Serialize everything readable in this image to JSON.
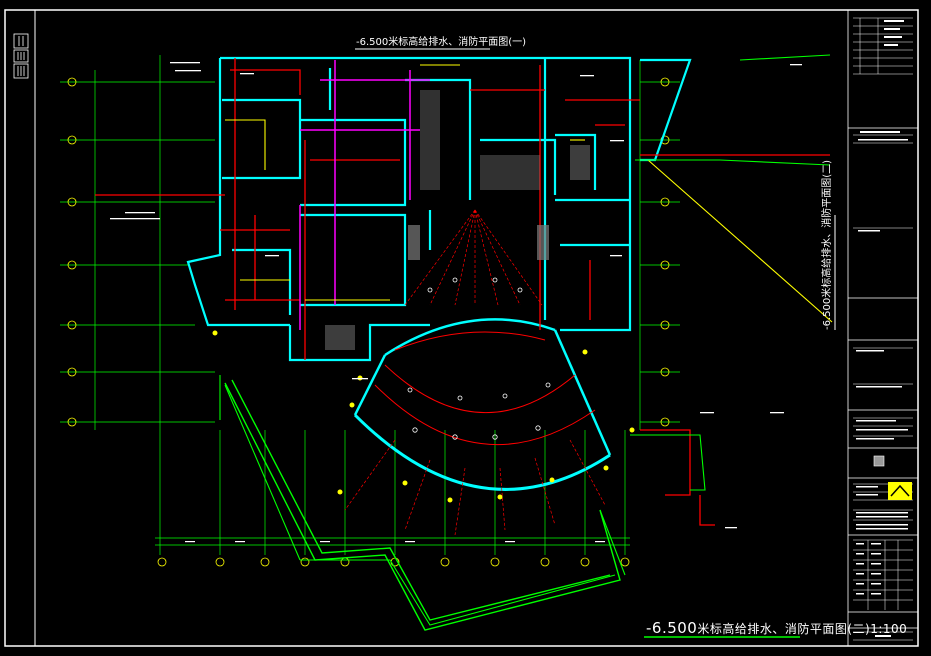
{
  "drawing": {
    "main_title_elevation": "-6.500",
    "main_title_text": "米标高给排水、消防平面图(二)",
    "main_title_scale": "1:100",
    "top_title": "-6.500米标高给排水、消防平面图(一)",
    "side_title": "-6.500米标高给排水、消防平面图(二)"
  },
  "left_panel": {
    "marks": [
      "I",
      "II",
      "III"
    ]
  },
  "grid_labels": {
    "axes_count": 11
  },
  "colors": {
    "background": "#000000",
    "frame": "#ffffff",
    "grid": "#00ff00",
    "wall": "#00ffff",
    "fire_pipe": "#ff0000",
    "drain_pipe": "#ffff00",
    "water_pipe": "#ff00ff",
    "hatch": "#808080"
  }
}
